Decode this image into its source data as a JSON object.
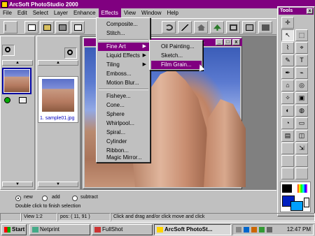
{
  "app": {
    "title": "ArcSoft PhotoStudio 2000"
  },
  "menubar": [
    "File",
    "Edit",
    "Select",
    "Layer",
    "Enhance",
    "Effects",
    "View",
    "Window",
    "Help"
  ],
  "effects_menu": {
    "items": [
      "Composite...",
      "Stitch...",
      "Fine Art",
      "Liquid Effects",
      "Tiling",
      "Emboss...",
      "Motion Blur...",
      "Fisheye...",
      "Cone...",
      "Sphere",
      "Whirlpool...",
      "Spiral...",
      "Cylinder",
      "Ribbon...",
      "Magic Mirror..."
    ],
    "submenu_arrows": [
      "▶",
      "▶",
      "▶"
    ]
  },
  "fine_art_submenu": {
    "items": [
      "Oil Painting...",
      "Sketch...",
      "Film Grain..."
    ]
  },
  "image_window": {
    "title": "...."
  },
  "album": {
    "thumbnail_caption": "1. sample01.jpg"
  },
  "tools_palette": {
    "title": "Tools",
    "close_glyph": "x",
    "glyphs": [
      "✛",
      "↖",
      "⬚",
      "⌇",
      "⌖",
      "T",
      "✎",
      "✒",
      "⌁",
      "⌂",
      "◎",
      "✧",
      "▣",
      "◐",
      "◍",
      "◔",
      "▭",
      "▤",
      "◫",
      "⇲"
    ]
  },
  "options": {
    "modes": [
      "new",
      "add",
      "subtract"
    ],
    "hint": "Double click to finish selection"
  },
  "status": {
    "view": "View 1:2",
    "pos": "pos: ( 11, 91 )",
    "message": "Click and drag and/or click move and click"
  },
  "taskbar": {
    "start": "Start",
    "tasks": [
      "Netprint",
      "FullShot",
      "ArcSoft PhotoSt..."
    ],
    "clock": "12:47 PM"
  },
  "colors": {
    "accent": "#800080",
    "face": "#c0c0c0",
    "selection_blue": "#0000a0"
  }
}
